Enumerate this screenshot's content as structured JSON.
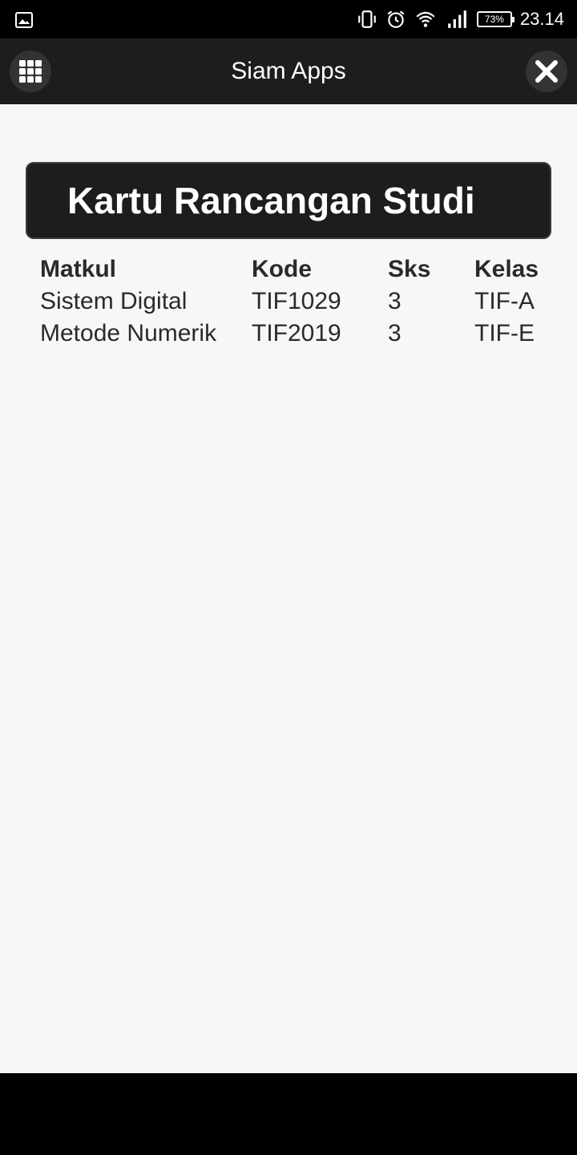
{
  "status_bar": {
    "battery": "73%",
    "time": "23.14",
    "icons": [
      "image-icon",
      "vibrate-icon",
      "alarm-icon",
      "wifi-icon",
      "signal-icon",
      "battery-icon"
    ]
  },
  "app_bar": {
    "title": "Siam Apps",
    "menu_icon": "grid-icon",
    "close_icon": "close-icon"
  },
  "card": {
    "title": "Kartu Rancangan Studi"
  },
  "table": {
    "headers": [
      "Matkul",
      "Kode",
      "Sks",
      "Kelas"
    ],
    "rows": [
      [
        "Sistem Digital",
        "TIF1029",
        "3",
        "TIF-A"
      ],
      [
        "Metode Numerik",
        "TIF2019",
        "3",
        "TIF-E"
      ]
    ]
  },
  "colors": {
    "app_bar": "#1d1d1d",
    "background": "#f7f7f7",
    "text": "#2a2a2a"
  }
}
